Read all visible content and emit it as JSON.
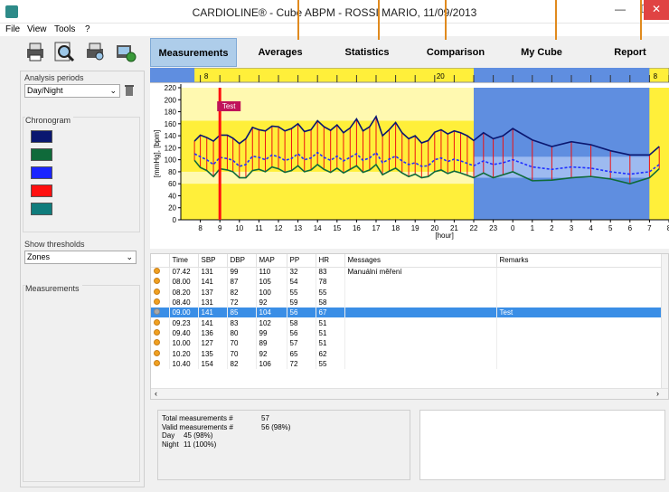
{
  "window": {
    "title": "CARDIOLINE® - Cube ABPM - ROSSI MARIO, 11/09/2013"
  },
  "menu": [
    "File",
    "View",
    "Tools",
    "?"
  ],
  "toolbar": [
    "print-icon",
    "magnifier-icon",
    "print-preview-icon",
    "export-icon"
  ],
  "tabs": [
    {
      "label": "Measurements",
      "active": true
    },
    {
      "label": "Averages",
      "active": false
    },
    {
      "label": "Statistics",
      "active": false
    },
    {
      "label": "Comparison",
      "active": false
    },
    {
      "label": "My Cube",
      "active": false
    },
    {
      "label": "Report",
      "active": false
    }
  ],
  "left": {
    "analysis_label": "Analysis periods",
    "analysis_value": "Day/Night",
    "chronogram_label": "Chronogram",
    "swatches": [
      "#0a1770",
      "#0f6a3a",
      "#1a24ff",
      "#ff0f0f",
      "#0f7c7c"
    ],
    "thresholds_label": "Show thresholds",
    "thresholds_value": "Zones",
    "measurements_label": "Measurements"
  },
  "chart_data": {
    "type": "line",
    "ylabel": "[mmHg], [bpm]",
    "xlabel": "[hour]",
    "ylim": [
      0,
      220
    ],
    "yticks": [
      0,
      20,
      40,
      60,
      80,
      100,
      120,
      140,
      160,
      180,
      200,
      220
    ],
    "x_hours": [
      8,
      9,
      10,
      11,
      12,
      13,
      14,
      15,
      16,
      17,
      18,
      19,
      20,
      21,
      22,
      23,
      0,
      1,
      2,
      3,
      4,
      5,
      6,
      7,
      8
    ],
    "top_scale": [
      "8",
      "20",
      "8"
    ],
    "marker_label": "Test",
    "marker_hour": 9.0,
    "night_start": 22.0,
    "night_end": 31.0,
    "series": [
      {
        "x": [
          7.7,
          8.0,
          8.33,
          8.67,
          9.0,
          9.38,
          9.67,
          10.0,
          10.33,
          10.67,
          11.0,
          11.33,
          11.67,
          12.0,
          12.33,
          12.67,
          13.0,
          13.33,
          13.67,
          14.0,
          14.33,
          14.67,
          15.0,
          15.33,
          15.67,
          16.0,
          16.33,
          16.67,
          17.0,
          17.33,
          17.67,
          18.0,
          18.33,
          18.67,
          19.0,
          19.33,
          19.67,
          20.0,
          20.33,
          20.67,
          21.0,
          21.33,
          21.67,
          22.0,
          22.5,
          23.0,
          23.5,
          24.0,
          25.0,
          26.0,
          27.0,
          28.0,
          29.0,
          30.0,
          31.0,
          31.5
        ],
        "values": [
          131,
          141,
          137,
          131,
          141,
          141,
          136,
          127,
          135,
          154,
          150,
          148,
          156,
          155,
          148,
          152,
          160,
          147,
          150,
          165,
          155,
          149,
          158,
          145,
          153,
          168,
          148,
          155,
          172,
          140,
          150,
          162,
          145,
          135,
          140,
          128,
          132,
          146,
          150,
          143,
          148,
          145,
          140,
          132,
          145,
          135,
          140,
          152,
          133,
          122,
          130,
          125,
          115,
          108,
          108,
          122
        ]
      },
      {
        "x": [
          7.7,
          8.0,
          8.33,
          8.67,
          9.0,
          9.38,
          9.67,
          10.0,
          10.33,
          10.67,
          11.0,
          11.33,
          11.67,
          12.0,
          12.33,
          12.67,
          13.0,
          13.33,
          13.67,
          14.0,
          14.33,
          14.67,
          15.0,
          15.33,
          15.67,
          16.0,
          16.33,
          16.67,
          17.0,
          17.33,
          17.67,
          18.0,
          18.33,
          18.67,
          19.0,
          19.33,
          19.67,
          20.0,
          20.33,
          20.67,
          21.0,
          21.33,
          21.67,
          22.0,
          22.5,
          23.0,
          23.5,
          24.0,
          25.0,
          26.0,
          27.0,
          28.0,
          29.0,
          30.0,
          31.0,
          31.5
        ],
        "values": [
          110,
          105,
          100,
          92,
          104,
          102,
          99,
          89,
          92,
          106,
          104,
          100,
          108,
          105,
          99,
          102,
          110,
          100,
          103,
          112,
          104,
          99,
          106,
          98,
          104,
          110,
          99,
          103,
          112,
          95,
          101,
          106,
          98,
          92,
          95,
          89,
          90,
          100,
          103,
          97,
          101,
          98,
          94,
          90,
          98,
          92,
          95,
          100,
          88,
          84,
          88,
          86,
          80,
          76,
          80,
          92
        ]
      },
      {
        "x": [
          7.7,
          8.0,
          8.33,
          8.67,
          9.0,
          9.38,
          9.67,
          10.0,
          10.33,
          10.67,
          11.0,
          11.33,
          11.67,
          12.0,
          12.33,
          12.67,
          13.0,
          13.33,
          13.67,
          14.0,
          14.33,
          14.67,
          15.0,
          15.33,
          15.67,
          16.0,
          16.33,
          16.67,
          17.0,
          17.33,
          17.67,
          18.0,
          18.33,
          18.67,
          19.0,
          19.33,
          19.67,
          20.0,
          20.33,
          20.67,
          21.0,
          21.33,
          21.67,
          22.0,
          22.5,
          23.0,
          23.5,
          24.0,
          25.0,
          26.0,
          27.0,
          28.0,
          29.0,
          30.0,
          31.0,
          31.5
        ],
        "values": [
          99,
          87,
          82,
          72,
          85,
          83,
          80,
          70,
          70,
          82,
          84,
          80,
          88,
          85,
          79,
          82,
          90,
          80,
          83,
          92,
          84,
          79,
          86,
          78,
          84,
          90,
          79,
          83,
          92,
          75,
          81,
          86,
          78,
          72,
          76,
          70,
          72,
          80,
          83,
          77,
          81,
          78,
          74,
          70,
          78,
          70,
          75,
          80,
          65,
          66,
          70,
          72,
          68,
          60,
          70,
          85
        ]
      }
    ]
  },
  "table": {
    "columns": [
      "Time",
      "SBP",
      "DBP",
      "MAP",
      "PP",
      "HR",
      "Messages",
      "Remarks"
    ],
    "rows": [
      {
        "time": "07.42",
        "sbp": "131",
        "dbp": "99",
        "map": "110",
        "pp": "32",
        "hr": "83",
        "msg": "Manuální měření",
        "rem": "",
        "sel": false
      },
      {
        "time": "08.00",
        "sbp": "141",
        "dbp": "87",
        "map": "105",
        "pp": "54",
        "hr": "78",
        "msg": "",
        "rem": "",
        "sel": false
      },
      {
        "time": "08.20",
        "sbp": "137",
        "dbp": "82",
        "map": "100",
        "pp": "55",
        "hr": "55",
        "msg": "",
        "rem": "",
        "sel": false
      },
      {
        "time": "08.40",
        "sbp": "131",
        "dbp": "72",
        "map": "92",
        "pp": "59",
        "hr": "58",
        "msg": "",
        "rem": "",
        "sel": false
      },
      {
        "time": "09.00",
        "sbp": "141",
        "dbp": "85",
        "map": "104",
        "pp": "56",
        "hr": "67",
        "msg": "",
        "rem": "Test",
        "sel": true
      },
      {
        "time": "09.23",
        "sbp": "141",
        "dbp": "83",
        "map": "102",
        "pp": "58",
        "hr": "51",
        "msg": "",
        "rem": "",
        "sel": false
      },
      {
        "time": "09.40",
        "sbp": "136",
        "dbp": "80",
        "map": "99",
        "pp": "56",
        "hr": "51",
        "msg": "",
        "rem": "",
        "sel": false
      },
      {
        "time": "10.00",
        "sbp": "127",
        "dbp": "70",
        "map": "89",
        "pp": "57",
        "hr": "51",
        "msg": "",
        "rem": "",
        "sel": false
      },
      {
        "time": "10.20",
        "sbp": "135",
        "dbp": "70",
        "map": "92",
        "pp": "65",
        "hr": "62",
        "msg": "",
        "rem": "",
        "sel": false
      },
      {
        "time": "10.40",
        "sbp": "154",
        "dbp": "82",
        "map": "106",
        "pp": "72",
        "hr": "55",
        "msg": "",
        "rem": "",
        "sel": false
      }
    ]
  },
  "summary": {
    "lines": [
      {
        "label": "Total measurements #",
        "value": "57"
      },
      {
        "label": "Valid measurements #",
        "value": "56 (98%)"
      },
      {
        "label": "Day",
        "value": "45 (98%)"
      },
      {
        "label": "Night",
        "value": "11 (100%)"
      }
    ]
  }
}
